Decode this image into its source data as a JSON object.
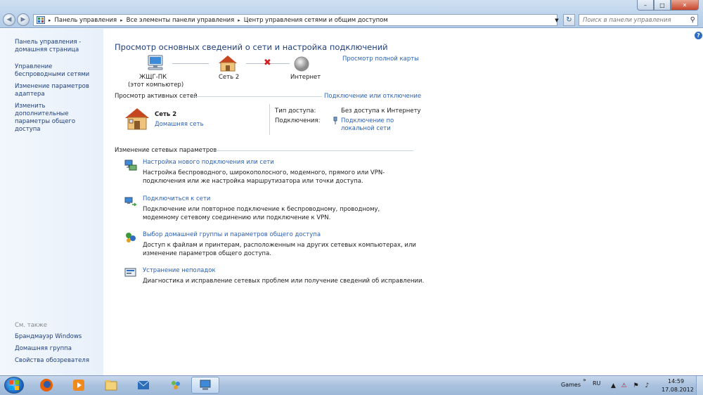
{
  "window": {
    "controls": {
      "minimize": "–",
      "maximize": "□",
      "close": "✕"
    }
  },
  "address_bar": {
    "crumbs": [
      "Панель управления",
      "Все элементы панели управления",
      "Центр управления сетями и общим доступом"
    ],
    "search_placeholder": "Поиск в панели управления"
  },
  "sidebar": {
    "items": [
      "Панель управления - домашняя страница",
      "Управление беспроводными сетями",
      "Изменение параметров адаптера",
      "Изменить дополнительные параметры общего доступа"
    ],
    "see_also_label": "См. также",
    "see_also": [
      "Брандмауэр Windows",
      "Домашняя группа",
      "Свойства обозревателя"
    ]
  },
  "main": {
    "title": "Просмотр основных сведений о сети и настройка подключений",
    "full_map_link": "Просмотр полной карты",
    "map": {
      "computer_name": "ЖЩГ-ПК",
      "computer_sub": "(этот компьютер)",
      "network_name": "Сеть 2",
      "internet": "Интернет"
    },
    "active_networks": {
      "section_title": "Просмотр активных сетей",
      "connect_link": "Подключение или отключение",
      "network_name": "Сеть  2",
      "network_type": "Домашняя сеть",
      "access_type_label": "Тип доступа:",
      "access_type_value": "Без доступа к Интернету",
      "connections_label": "Подключения:",
      "connections_value": "Подключение по локальной сети"
    },
    "change_settings": {
      "section_title": "Изменение сетевых параметров",
      "tasks": [
        {
          "title": "Настройка нового подключения или сети",
          "desc": "Настройка беспроводного, широкополосного, модемного, прямого или VPN-подключения или же настройка маршрутизатора или точки доступа.",
          "icon": "new-connection-icon"
        },
        {
          "title": "Подключиться к сети",
          "desc": "Подключение или повторное подключение к беспроводному, проводному, модемному сетевому соединению или подключение к VPN.",
          "icon": "connect-network-icon"
        },
        {
          "title": "Выбор домашней группы и параметров общего доступа",
          "desc": "Доступ к файлам и принтерам, расположенным на других сетевых компьютерах, или изменение параметров общего доступа.",
          "icon": "homegroup-icon"
        },
        {
          "title": "Устранение неполадок",
          "desc": "Диагностика и исправление сетевых проблем или получение сведений об исправлении.",
          "icon": "troubleshoot-icon"
        }
      ]
    }
  },
  "taskbar": {
    "apps": [
      "firefox-icon",
      "media-player-icon",
      "explorer-icon",
      "mail-icon",
      "people-icon",
      "network-center-icon"
    ],
    "toolbar_label": "Games",
    "language": "RU",
    "time": "14:59",
    "date": "17.08.2012"
  },
  "colors": {
    "link": "#2a5fb4",
    "heading": "#1e3f7e",
    "sidebar_bg": "#eef4fb",
    "error_x": "#d42020"
  }
}
